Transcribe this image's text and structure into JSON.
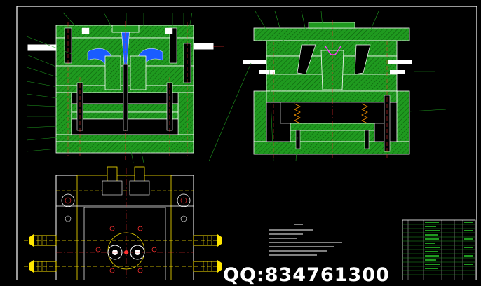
{
  "drawing": {
    "background_color": "#000000",
    "palette": {
      "plate_green": "#1f9a1f",
      "outline_white": "#ffffff",
      "hatch_red": "#ff3030",
      "cavity_blue": "#1a5cff",
      "yellow": "#ffe600",
      "cyan": "#00d4ff",
      "magenta": "#ff3cff",
      "orange": "#ff9a00"
    }
  },
  "views": {
    "front_section": "main-sectional-view",
    "side_section": "side-sectional-view",
    "plan": "top-plan-view",
    "title_table": "bill-of-materials-table"
  },
  "overlay": {
    "contact_text": "QQ:834761300"
  }
}
